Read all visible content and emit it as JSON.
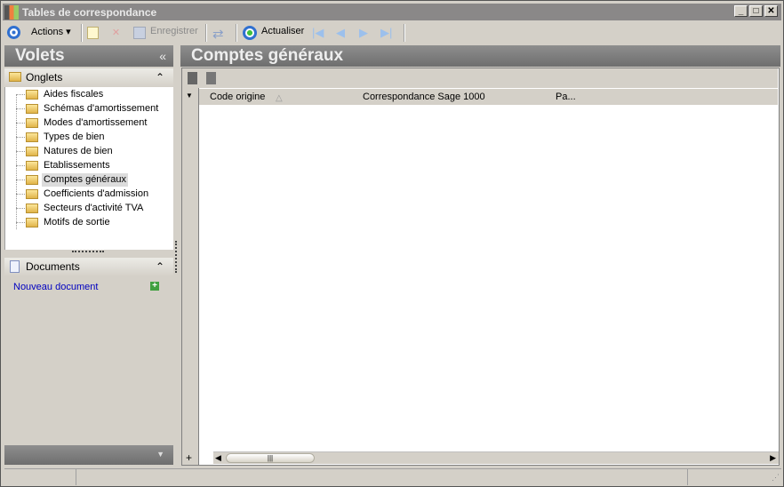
{
  "window": {
    "title": "Tables de correspondance",
    "min": "_",
    "max": "□",
    "close": "✕"
  },
  "toolbar": {
    "actions": "Actions",
    "save": "Enregistrer",
    "refresh": "Actualiser"
  },
  "left": {
    "title": "Volets",
    "collapse": "«",
    "tabs_section": "Onglets",
    "docs_section": "Documents",
    "new_doc": "Nouveau document",
    "items": [
      "Aides fiscales",
      "Schémas d'amortissement",
      "Modes d'amortissement",
      "Types de bien",
      "Natures de bien",
      "Etablissements",
      "Comptes généraux",
      "Coefficients d'admission",
      "Secteurs d'activité TVA",
      "Motifs de sortie"
    ],
    "selected": "Comptes généraux"
  },
  "main": {
    "title": "Comptes généraux",
    "columns": [
      "Code origine",
      "Correspondance Sage 1000",
      "Pa..."
    ],
    "sort_column": "Code origine",
    "add": "+"
  }
}
